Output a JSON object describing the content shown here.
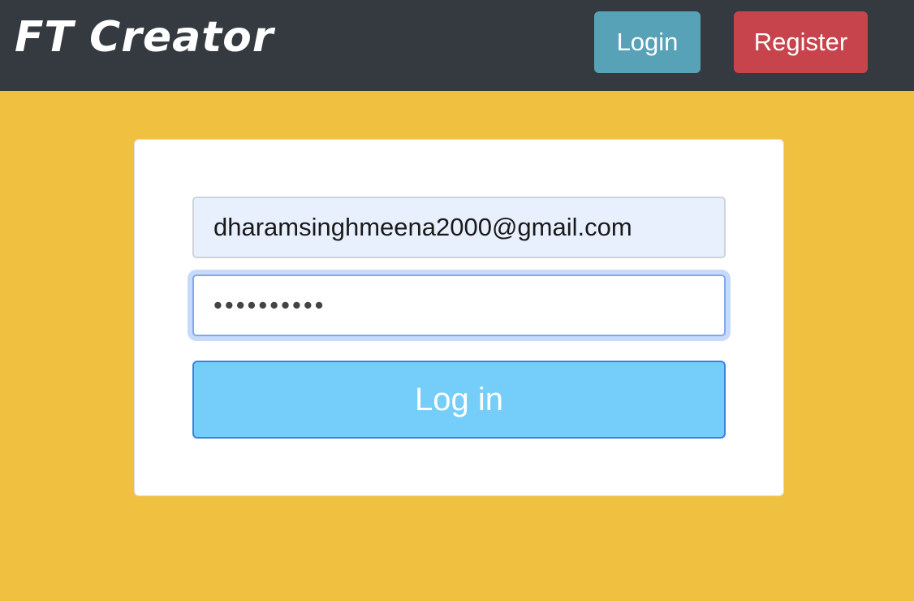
{
  "navbar": {
    "brand": "FT Creator",
    "login_label": "Login",
    "register_label": "Register"
  },
  "form": {
    "email_value": "dharamsinghmeena2000@gmail.com",
    "password_value": "••••••••••",
    "submit_label": "Log in"
  },
  "colors": {
    "page_background": "#f0c040",
    "navbar_background": "#343a40",
    "login_button": "#58a2b8",
    "register_button": "#c8444c",
    "submit_button": "#75cdfa",
    "email_autofill": "#e8f0fe"
  }
}
